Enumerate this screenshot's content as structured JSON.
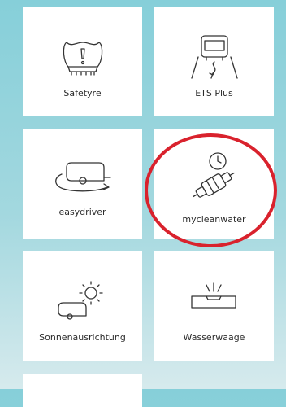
{
  "tiles": [
    {
      "label": "Safetyre",
      "icon": "tyre-warning-icon"
    },
    {
      "label": "ETS Plus",
      "icon": "caravan-road-icon"
    },
    {
      "label": "easydriver",
      "icon": "caravan-rotate-icon"
    },
    {
      "label": "mycleanwater",
      "icon": "water-filter-clock-icon"
    },
    {
      "label": "Sonnenausrichtung",
      "icon": "caravan-sun-icon"
    },
    {
      "label": "Wasserwaage",
      "icon": "spirit-level-icon"
    }
  ],
  "colors": {
    "highlight": "#d9222d",
    "tile": "#ffffff",
    "background": "#86cfd9"
  }
}
